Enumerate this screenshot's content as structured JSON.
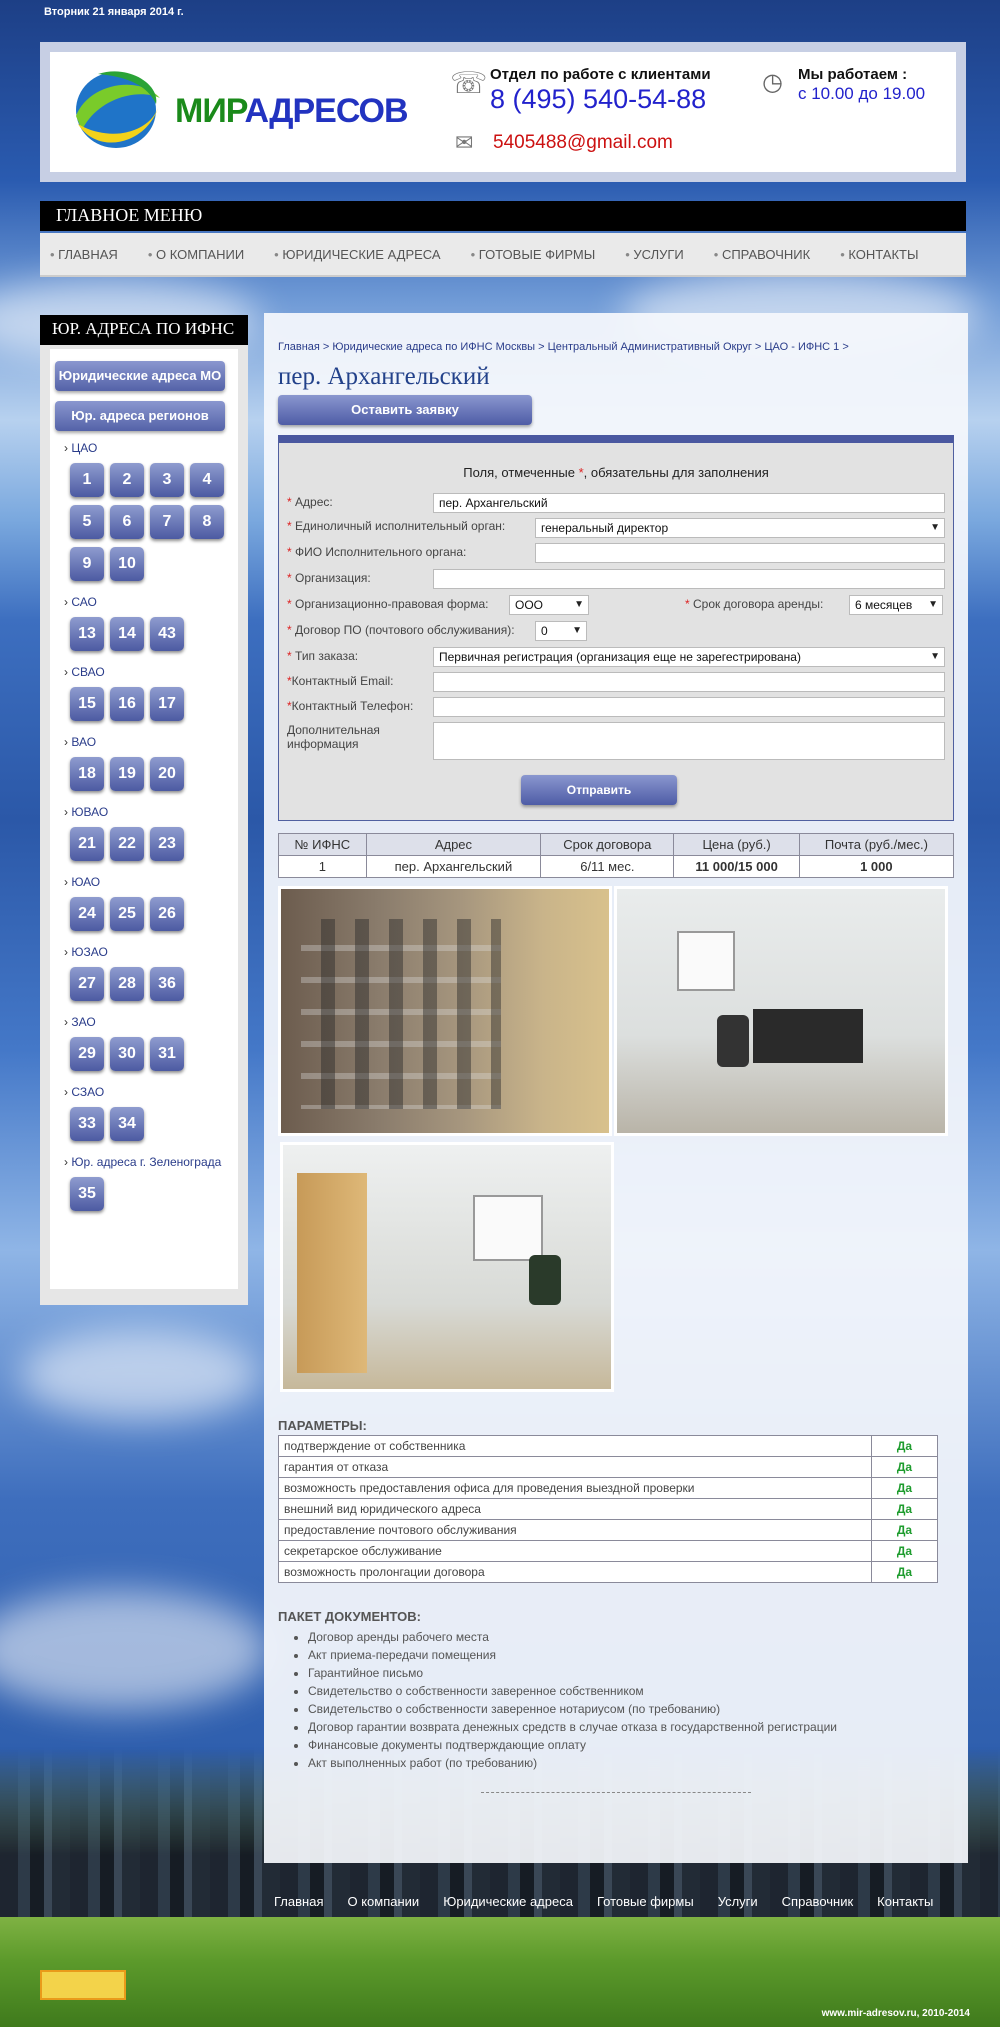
{
  "date": "Вторник 21 января 2014 г.",
  "header": {
    "logo_part1": "МИР",
    "logo_part2": "АДРЕСОВ",
    "dept": "Отдел по работе с клиентами",
    "phone": "8 (495) 540-54-88",
    "email": "5405488@gmail.com",
    "hours_title": "Мы работаем :",
    "hours": "с 10.00 до 19.00"
  },
  "menu": {
    "title": "ГЛАВНОЕ МЕНЮ",
    "items": [
      "ГЛАВНАЯ",
      "О КОМПАНИИ",
      "ЮРИДИЧЕСКИЕ АДРЕСА",
      "ГОТОВЫЕ ФИРМЫ",
      "УСЛУГИ",
      "СПРАВОЧНИК",
      "КОНТАКТЫ"
    ]
  },
  "sidebar": {
    "title": "ЮР. АДРЕСА ПО ИФНС",
    "btn1": "Юридические адреса МО",
    "btn2": "Юр. адреса регионов",
    "groups": [
      {
        "name": "ЦАО",
        "tiles": [
          "1",
          "2",
          "3",
          "4",
          "5",
          "6",
          "7",
          "8",
          "9",
          "10"
        ]
      },
      {
        "name": "САО",
        "tiles": [
          "13",
          "14",
          "43"
        ]
      },
      {
        "name": "СВАО",
        "tiles": [
          "15",
          "16",
          "17"
        ]
      },
      {
        "name": "ВАО",
        "tiles": [
          "18",
          "19",
          "20"
        ]
      },
      {
        "name": "ЮВАО",
        "tiles": [
          "21",
          "22",
          "23"
        ]
      },
      {
        "name": "ЮАО",
        "tiles": [
          "24",
          "25",
          "26"
        ]
      },
      {
        "name": "ЮЗАО",
        "tiles": [
          "27",
          "28",
          "36"
        ]
      },
      {
        "name": "ЗАО",
        "tiles": [
          "29",
          "30",
          "31"
        ]
      },
      {
        "name": "СЗАО",
        "tiles": [
          "33",
          "34"
        ]
      },
      {
        "name": "Юр. адреса г. Зеленограда",
        "tiles": [
          "35"
        ]
      }
    ]
  },
  "breadcrumbs": "Главная > Юридические адреса по ИФНС Москвы > Центральный Административный Округ > ЦАО - ИФНС 1 >",
  "page_title": "пер. Архангельский",
  "order_btn": "Оставить заявку",
  "form": {
    "note_before": "Поля, отмеченные ",
    "note_star": "*",
    "note_after": ", обязательны для заполнения",
    "star": "*",
    "labels": {
      "address": "Адрес:",
      "exec_organ": "Единоличный исполнительный орган:",
      "fio": "ФИО Исполнительного органа:",
      "org": "Организация:",
      "legal_form": "Организационно-правовая форма:",
      "term": "Срок договора аренды:",
      "po": "Договор ПО (почтового обслуживания):",
      "order_type": "Тип заказа:",
      "email": "Контактный Email:",
      "phone": "Контактный Телефон:",
      "info": "Дополнительная информация"
    },
    "values": {
      "address": "пер. Архангельский",
      "exec_organ": "генеральный директор",
      "legal_form": "ООО",
      "term": "6 месяцев",
      "po": "0",
      "order_type": "Первичная регистрация (организация еще не зарегестрирована)"
    },
    "submit": "Отправить"
  },
  "price_table": {
    "headers": [
      "№ ИФНС",
      "Адрес",
      "Срок договора",
      "Цена (руб.)",
      "Почта (руб./мес.)"
    ],
    "row": [
      "1",
      "пер. Архангельский",
      "6/11 мес.",
      "11 000/15 000",
      "1 000"
    ]
  },
  "params": {
    "title": "ПАРАМЕТРЫ:",
    "rows": [
      {
        "name": "подтверждение от собственника",
        "value": "Да"
      },
      {
        "name": "гарантия от отказа",
        "value": "Да"
      },
      {
        "name": "возможность предоставления офиса для проведения выездной проверки",
        "value": "Да"
      },
      {
        "name": "внешний вид юридического адреса",
        "value": "Да"
      },
      {
        "name": "предоставление почтового обслуживания",
        "value": "Да"
      },
      {
        "name": "секретарское обслуживание",
        "value": "Да"
      },
      {
        "name": "возможность пролонгации договора",
        "value": "Да"
      }
    ]
  },
  "docs": {
    "title": "ПАКЕТ ДОКУМЕНТОВ:",
    "items": [
      "Договор аренды рабочего места",
      "Акт приема-передачи помещения",
      "Гарантийное письмо",
      "Свидетельство о собственности заверенное собственником",
      "Свидетельство о собственности заверенное нотариусом (по требованию)",
      "Договор гарантии возврата денежных средств в случае отказа в государственной регистрации",
      "Финансовые документы подтверждающие оплату",
      "Акт выполненных работ (по требованию)"
    ]
  },
  "footer": {
    "menu": [
      "Главная",
      "О компании",
      "Юридические адреса",
      "Готовые фирмы",
      "Услуги",
      "Справочник",
      "Контакты"
    ],
    "copyright": "www.mir-adresov.ru, 2010-2014"
  }
}
